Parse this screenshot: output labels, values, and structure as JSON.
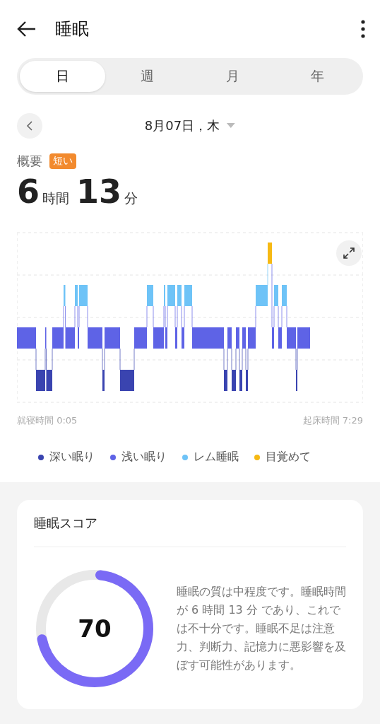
{
  "header": {
    "title": "睡眠"
  },
  "tabs": [
    {
      "label": "日",
      "selected": true
    },
    {
      "label": "週",
      "selected": false
    },
    {
      "label": "月",
      "selected": false
    },
    {
      "label": "年",
      "selected": false
    }
  ],
  "date": {
    "label": "8月07日，木"
  },
  "summary": {
    "label": "概要",
    "badge": "短い",
    "hours": "6",
    "hours_unit": "時間",
    "minutes": "13",
    "minutes_unit": "分"
  },
  "chart": {
    "start_label": "就寝時間 0:05",
    "end_label": "起床時間 7:29"
  },
  "legend": [
    {
      "label": "深い眠り",
      "color": "#3a44b0"
    },
    {
      "label": "浅い眠り",
      "color": "#5e63e6"
    },
    {
      "label": "レム睡眠",
      "color": "#6ec3f7"
    },
    {
      "label": "目覚めて",
      "color": "#f6b914"
    }
  ],
  "score_card": {
    "title": "睡眠スコア",
    "score": "70",
    "description": "睡眠の質は中程度です。睡眠時間が 6 時間 13 分 であり、これでは不十分です。睡眠不足は注意力、判断力、記憶力に悪影響を及ぼす可能性があります。"
  }
}
